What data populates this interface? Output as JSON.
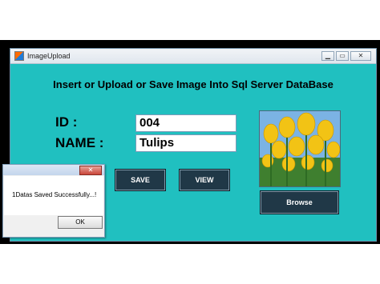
{
  "window": {
    "title": "ImageUpload"
  },
  "heading": "Insert or Upload or Save Image Into Sql Server DataBase",
  "form": {
    "id_label": "ID  :",
    "name_label": "NAME  :",
    "id_value": "004",
    "name_value": "Tulips"
  },
  "buttons": {
    "save": "SAVE",
    "view": "VIEW",
    "browse": "Browse"
  },
  "message_box": {
    "text": "1Datas Saved Successfully...!",
    "ok": "OK",
    "close": "✕"
  },
  "icons": {
    "minimize": "▁",
    "maximize": "▭",
    "close": "✕"
  }
}
